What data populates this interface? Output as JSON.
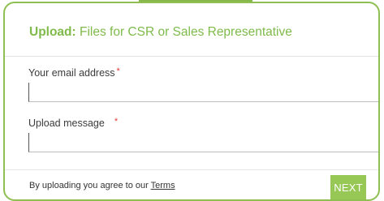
{
  "form": {
    "title_prefix": "Upload:",
    "title_rest": " Files for CSR or Sales Representative",
    "email": {
      "label": "Your email address",
      "required_mark": "*",
      "value": "",
      "placeholder": ""
    },
    "message": {
      "label": "Upload message",
      "required_mark": "*",
      "value": "",
      "placeholder": ""
    },
    "footer": {
      "agree_text": "By uploading you agree to our ",
      "terms_link": "Terms",
      "next_label": "NEXT"
    }
  },
  "colors": {
    "accent": "#8fbf52",
    "title": "#7fba4a",
    "button": "#97c855",
    "required": "#e23a3a"
  }
}
